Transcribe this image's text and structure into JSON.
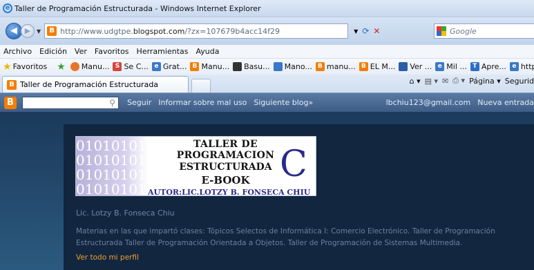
{
  "window": {
    "title": "Taller de Programación Estructurada - Windows Internet Explorer"
  },
  "address": {
    "url_prefix": "http://www.udgtpe.",
    "url_domain": "blogspot.com",
    "url_suffix": "/?zx=107679b4acc14f29",
    "search_placeholder": "Google"
  },
  "menu": [
    "Archivo",
    "Edición",
    "Ver",
    "Favoritos",
    "Herramientas",
    "Ayuda"
  ],
  "favorites": {
    "label": "Favoritos",
    "items": [
      {
        "label": "Manu...",
        "icon": "firefox-icon",
        "color": "#e8742a"
      },
      {
        "label": "Se C...",
        "icon": "s-icon",
        "color": "#d6453a"
      },
      {
        "label": "Grat...",
        "icon": "ie-page-icon",
        "color": "#3a78c8"
      },
      {
        "label": "Manu...",
        "icon": "blogger-icon",
        "color": "#f57d00"
      },
      {
        "label": "Basu...",
        "icon": "bulb-icon",
        "color": "#333333"
      },
      {
        "label": "Mano...",
        "icon": "gear-icon",
        "color": "#3a78c8"
      },
      {
        "label": "manu...",
        "icon": "blogger-icon",
        "color": "#f57d00"
      },
      {
        "label": "EL M...",
        "icon": "blogger-icon",
        "color": "#f57d00"
      },
      {
        "label": "Ver ...",
        "icon": "chart-icon",
        "color": "#2a5fa8"
      },
      {
        "label": "Mil ...",
        "icon": "ie-page-icon",
        "color": "#3a78c8"
      },
      {
        "label": "Apre...",
        "icon": "t-icon",
        "color": "#2a6ec7"
      },
      {
        "label": "http...",
        "icon": "ie-page-icon",
        "color": "#3a78c8"
      }
    ]
  },
  "tab": {
    "label": "Taller de Programación Estructurada"
  },
  "commandbar": {
    "page": "Página ▾",
    "security": "Segurid"
  },
  "bloggerbar": {
    "links": [
      "Seguir",
      "Informar sobre mal uso",
      "Siguiente blog»"
    ],
    "email": "lbchiu123@gmail.com",
    "new_post": "Nueva entrada"
  },
  "banner": {
    "binary_lines": [
      "01010101",
      "01010101",
      "01010101",
      "01010101"
    ],
    "line1": "TALLER DE PROGRAMACION",
    "line2": "ESTRUCTURADA",
    "line3": "E-BOOK",
    "line4": "AUTOR:LIC.LOTZY B. FONSECA CHIU",
    "big_letter": "C"
  },
  "profile": {
    "name": "Lic. Lotzy B. Fonseca Chiu",
    "description": "Materias en las que impartó clases: Tópicos Selectos de Informática I: Comercio Electrónico. Taller de Programación Estructurada Taller de Programación Orientada a Objetos. Taller de Programación de Sistemas Multimedia.",
    "link": "Ver todo mi perfil"
  }
}
